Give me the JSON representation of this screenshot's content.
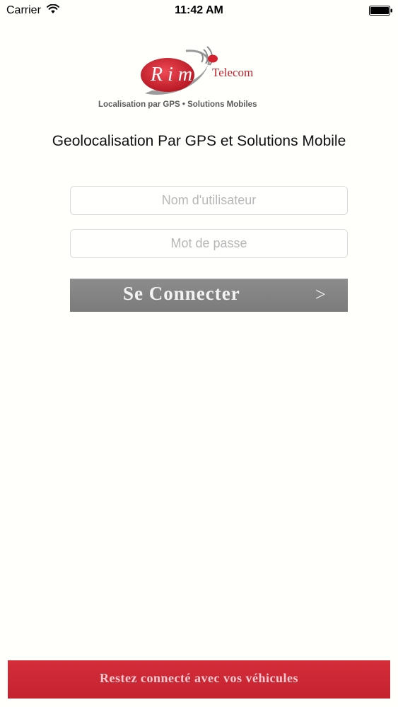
{
  "status_bar": {
    "carrier": "Carrier",
    "time": "11:42 AM",
    "wifi_icon": "wifi-icon",
    "battery_icon": "battery-icon"
  },
  "logo": {
    "mark_letters": "R i m",
    "brand": "Telecom",
    "tagline": "Localisation par GPS • Solutions Mobiles",
    "colors": {
      "red": "#d4212f",
      "gray": "#7a7a7a"
    }
  },
  "headline": "Geolocalisation Par GPS et Solutions Mobile",
  "login": {
    "username_placeholder": "Nom d'utilisateur",
    "username_value": "",
    "password_placeholder": "Mot de passe",
    "password_value": "",
    "connect_label": "Se Connecter",
    "connect_arrow": ">"
  },
  "footer": {
    "text": "Restez connecté avec vos véhicules",
    "color": "#d0283a"
  }
}
